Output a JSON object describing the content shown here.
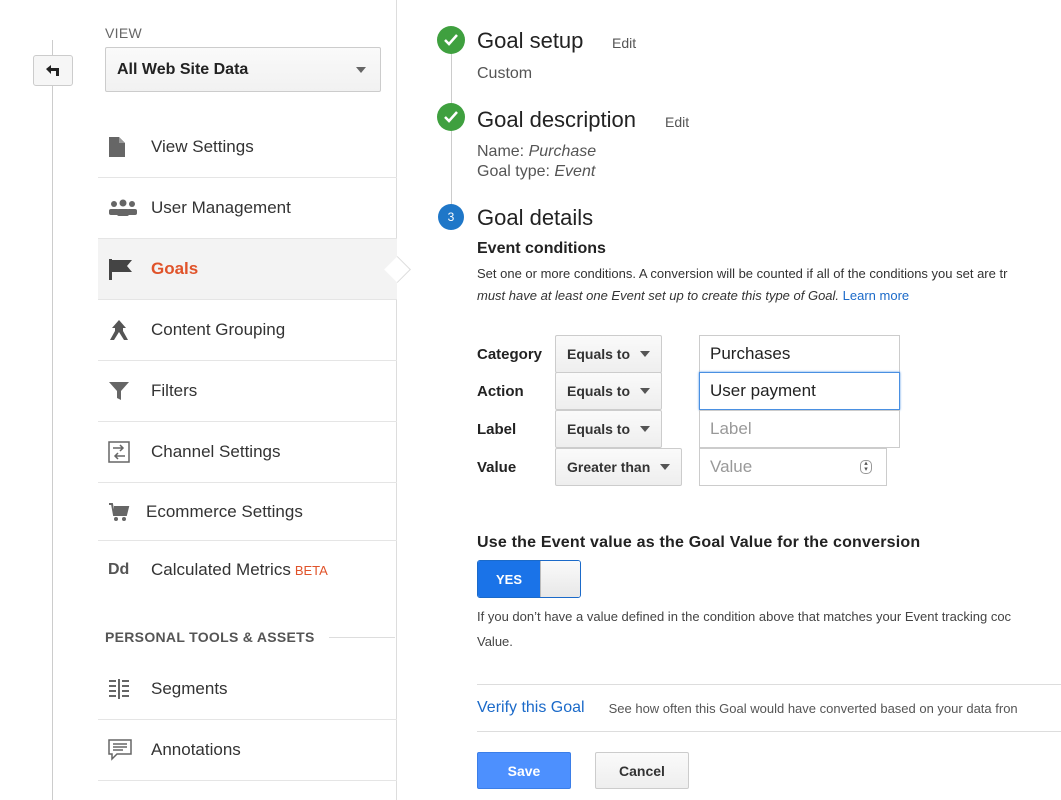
{
  "sidebar": {
    "view_label": "VIEW",
    "view_select": "All Web Site Data",
    "items": [
      {
        "label": "View Settings",
        "icon": "document-icon"
      },
      {
        "label": "User Management",
        "icon": "users-icon"
      },
      {
        "label": "Goals",
        "icon": "flag-icon"
      },
      {
        "label": "Content Grouping",
        "icon": "content-grouping-icon"
      },
      {
        "label": "Filters",
        "icon": "filter-icon"
      },
      {
        "label": "Channel Settings",
        "icon": "channel-settings-icon"
      },
      {
        "label": "Ecommerce Settings",
        "icon": "cart-icon"
      },
      {
        "label": "Calculated Metrics",
        "beta": "BETA",
        "icon": "calculated-metrics-icon"
      }
    ],
    "section_title": "PERSONAL TOOLS & ASSETS",
    "tools": [
      {
        "label": "Segments",
        "icon": "segments-icon"
      },
      {
        "label": "Annotations",
        "icon": "annotations-icon"
      }
    ]
  },
  "steps": {
    "setup": {
      "title": "Goal setup",
      "edit": "Edit",
      "value": "Custom"
    },
    "description": {
      "title": "Goal description",
      "edit": "Edit",
      "name_label": "Name: ",
      "name_value": "Purchase",
      "type_label": "Goal type: ",
      "type_value": "Event"
    },
    "details": {
      "number": "3",
      "title": "Goal details",
      "subtitle": "Event conditions",
      "desc1": "Set one or more conditions. A conversion will be counted if all of the conditions you set are tr",
      "desc2": "must have at least one Event set up to create this type of Goal. ",
      "learn_more": "Learn more"
    }
  },
  "conditions": [
    {
      "label": "Category",
      "op": "Equals to",
      "value": "Purchases",
      "placeholder": ""
    },
    {
      "label": "Action",
      "op": "Equals to",
      "value": "User payment",
      "placeholder": ""
    },
    {
      "label": "Label",
      "op": "Equals to",
      "value": "",
      "placeholder": "Label"
    },
    {
      "label": "Value",
      "op": "Greater than",
      "value": "",
      "placeholder": "Value"
    }
  ],
  "goal_value": {
    "title": "Use the Event value as the Goal Value for the conversion",
    "toggle": "YES",
    "help1": "If you don’t have a value defined in the condition above that matches your Event tracking coc",
    "help2": "Value."
  },
  "verify": {
    "link": "Verify this Goal",
    "text": "See how often this Goal would have converted based on your data fron"
  },
  "buttons": {
    "save": "Save",
    "cancel": "Cancel"
  },
  "colors": {
    "accent": "#e0532a",
    "check": "#3fa03f",
    "step": "#1f77c8",
    "link": "#1b6ac9",
    "primary": "#4d90fe"
  }
}
